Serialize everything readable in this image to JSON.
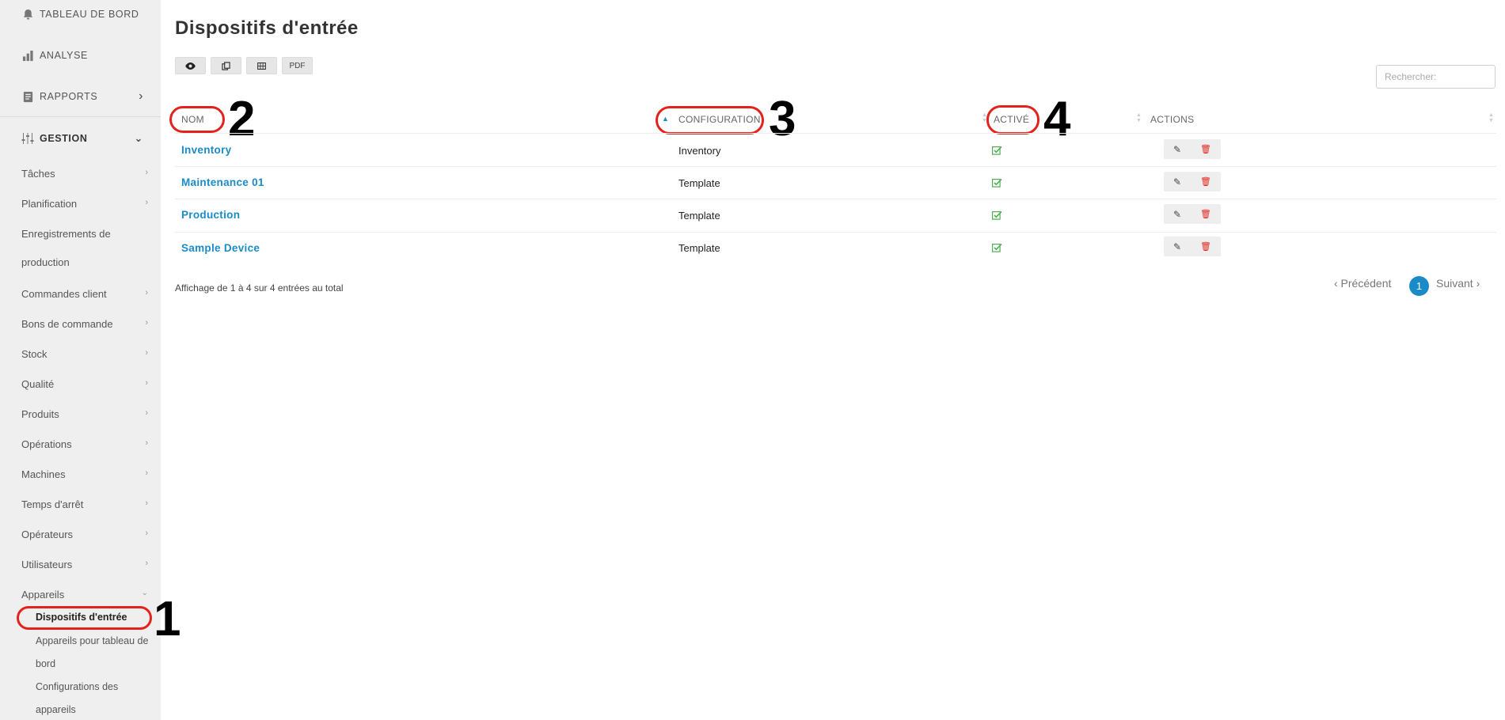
{
  "sidebar": {
    "main": [
      {
        "label": "TABLEAU DE BORD",
        "icon": "bell-icon"
      },
      {
        "label": "ANALYSE",
        "icon": "bar-chart-icon"
      },
      {
        "label": "RAPPORTS",
        "icon": "report-icon"
      },
      {
        "label": "GESTION",
        "icon": "sliders-icon"
      }
    ],
    "items": [
      {
        "label": "Tâches"
      },
      {
        "label": "Planification"
      },
      {
        "label": "Enregistrements de"
      },
      {
        "label": "production"
      },
      {
        "label": "Commandes client"
      },
      {
        "label": "Bons de commande"
      },
      {
        "label": "Stock"
      },
      {
        "label": "Qualité"
      },
      {
        "label": "Produits"
      },
      {
        "label": "Opérations"
      },
      {
        "label": "Machines"
      },
      {
        "label": "Temps d'arrêt"
      },
      {
        "label": "Opérateurs"
      },
      {
        "label": "Utilisateurs"
      },
      {
        "label": "Appareils"
      }
    ],
    "children": [
      {
        "label": "Dispositifs d'entrée"
      },
      {
        "label": "Appareils pour tableau de"
      },
      {
        "label": "bord"
      },
      {
        "label": "Configurations des"
      },
      {
        "label": "appareils"
      }
    ]
  },
  "page": {
    "title": "Dispositifs d'entrée",
    "toolbar": {
      "pdf_label": "PDF"
    },
    "search_placeholder": "Rechercher:"
  },
  "table": {
    "headers": [
      "NOM",
      "CONFIGURATION",
      "ACTIVÉ",
      "ACTIONS"
    ],
    "rows": [
      {
        "name": "Inventory",
        "configuration": "Inventory",
        "active": true
      },
      {
        "name": "Maintenance 01",
        "configuration": "Template",
        "active": true
      },
      {
        "name": "Production",
        "configuration": "Template",
        "active": true
      },
      {
        "name": "Sample Device",
        "configuration": "Template",
        "active": true
      }
    ],
    "info": "Affichage de 1 à 4 sur 4 entrées au total"
  },
  "pagination": {
    "prev": "‹ Précédent",
    "current": "1",
    "next": "Suivant ›"
  },
  "annotations": [
    "1",
    "2",
    "3",
    "4"
  ],
  "colors": {
    "accent": "#1a8bc7",
    "annotation": "#e3231b",
    "check": "#4caf50",
    "sidebar_bg": "#efefef"
  }
}
